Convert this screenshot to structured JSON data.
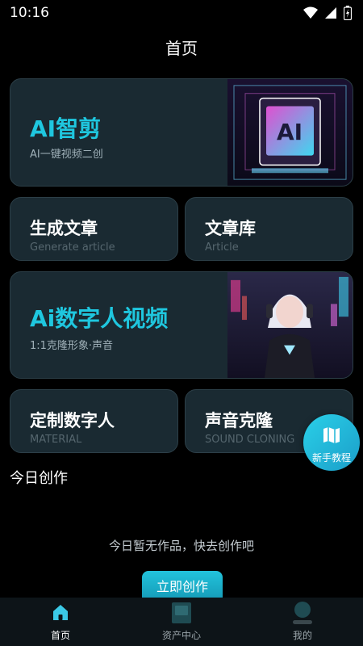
{
  "status_bar": {
    "time": "10:16"
  },
  "header": {
    "title": "首页"
  },
  "cards": {
    "ai_edit": {
      "title": "AI智剪",
      "subtitle": "AI一键视频二创"
    },
    "generate_article": {
      "title": "生成文章",
      "subtitle": "Generate article"
    },
    "article_library": {
      "title": "文章库",
      "subtitle": "Article"
    },
    "digital_human_video": {
      "title": "Ai数字人视频",
      "subtitle": "1:1克隆形象·声音"
    },
    "custom_digital_human": {
      "title": "定制数字人",
      "subtitle": "MATERIAL"
    },
    "voice_clone": {
      "title": "声音克隆",
      "subtitle": "SOUND CLONING"
    }
  },
  "fab": {
    "label": "新手教程",
    "icon": "map-icon"
  },
  "today": {
    "title": "今日创作",
    "empty_text": "今日暂无作品，快去创作吧",
    "create_button": "立即创作"
  },
  "bottom_nav": {
    "items": [
      {
        "label": "首页",
        "icon": "home-icon",
        "active": true
      },
      {
        "label": "资产中心",
        "icon": "assets-icon",
        "active": false
      },
      {
        "label": "我的",
        "icon": "profile-icon",
        "active": false
      }
    ]
  },
  "colors": {
    "accent": "#1fc7df",
    "background": "#000000",
    "card": "#1a2a32",
    "nav_active": "#ffffff",
    "nav_inactive": "#9aa5aa"
  }
}
